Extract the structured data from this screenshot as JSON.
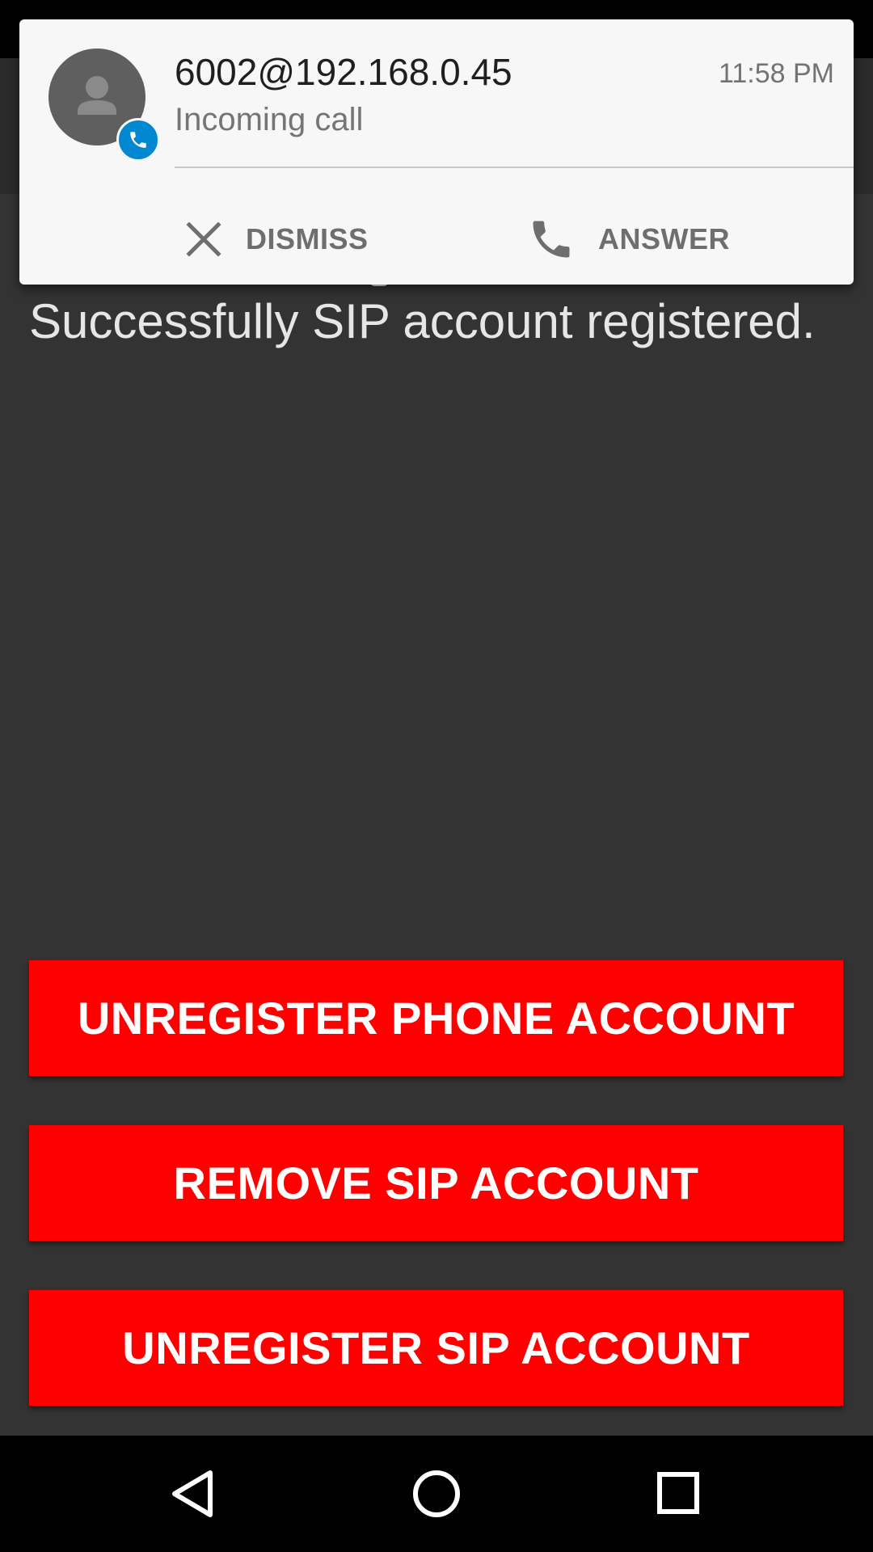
{
  "content": {
    "message": "Successfully SIP account registered."
  },
  "buttons": {
    "unregister_phone": "UNREGISTER PHONE ACCOUNT",
    "remove_sip": "REMOVE SIP ACCOUNT",
    "unregister_sip": "UNREGISTER SIP ACCOUNT"
  },
  "notification": {
    "caller": "6002@192.168.0.45",
    "time": "11:58 PM",
    "subtitle": "Incoming call",
    "dismiss_label": "DISMISS",
    "answer_label": "ANSWER",
    "avatar_icon": "person-icon",
    "badge_icon": "phone-icon",
    "badge_color": "#0288d1"
  },
  "colors": {
    "button_red": "#ff0000",
    "content_bg": "#333333"
  },
  "nav": {
    "back_icon": "back-triangle-icon",
    "home_icon": "home-circle-icon",
    "recent_icon": "recent-square-icon"
  }
}
